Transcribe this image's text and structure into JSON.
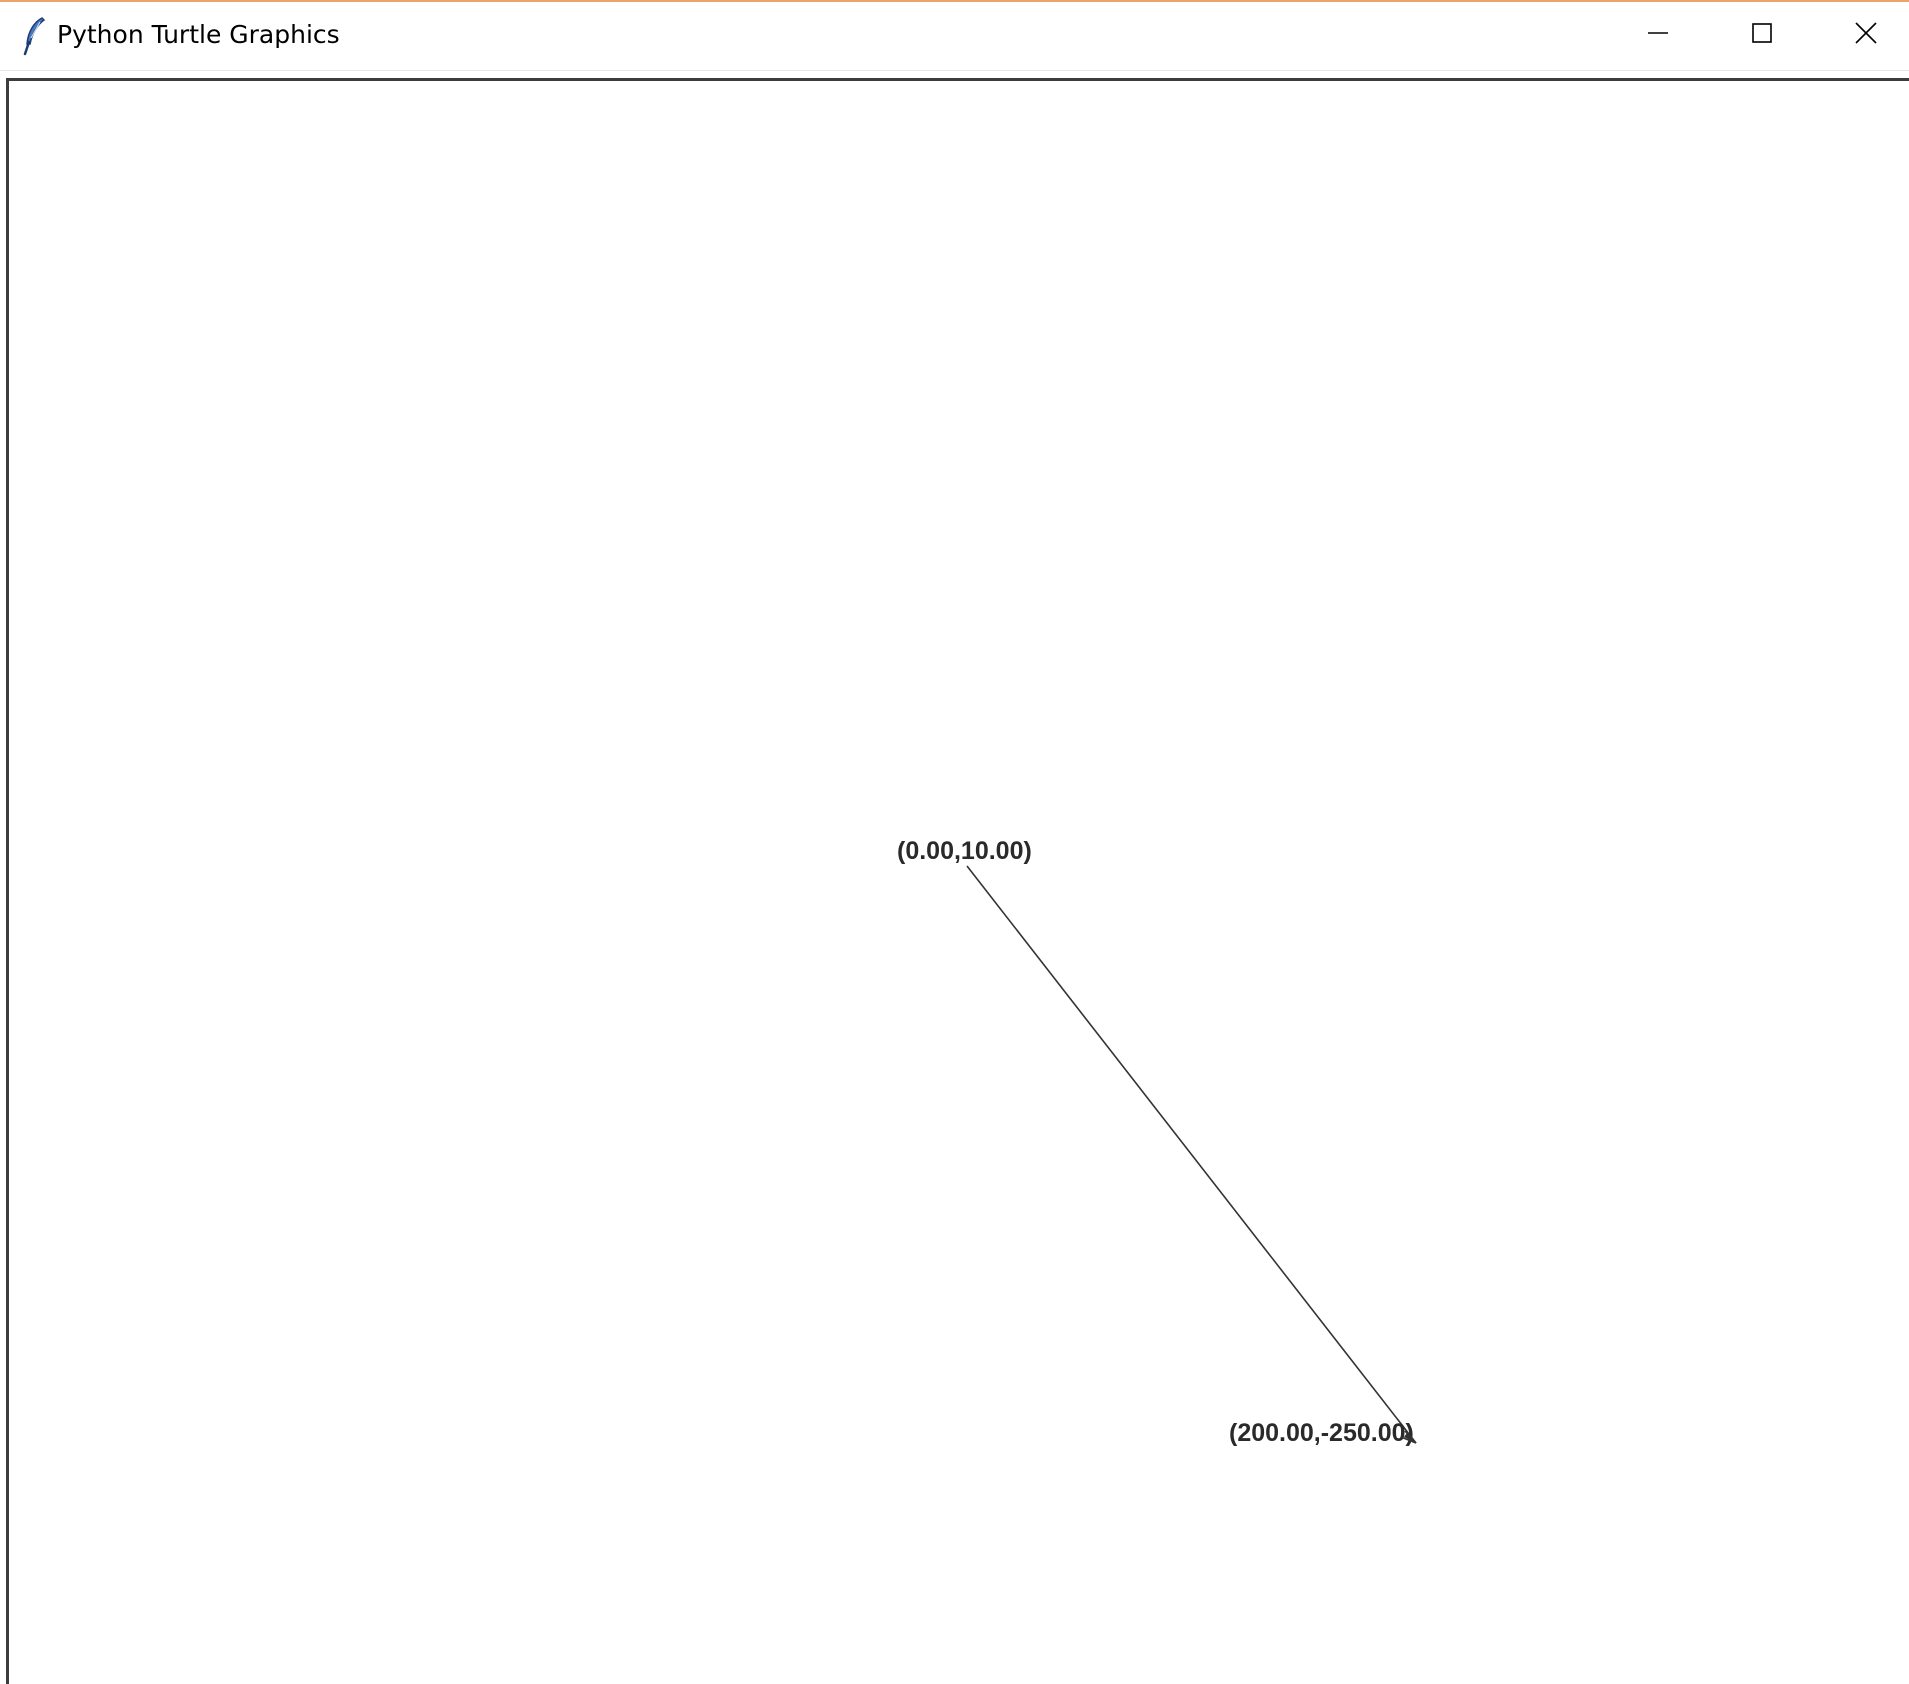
{
  "window": {
    "title": "Python Turtle Graphics",
    "icon": "feather-icon",
    "controls": {
      "minimize": "minimize-icon",
      "maximize": "maximize-icon",
      "close": "close-icon"
    }
  },
  "canvas": {
    "background": "#ffffff",
    "line_color": "#333333",
    "start_label": "(0.00,10.00)",
    "end_label": "(200.00,-250.00)",
    "segment": {
      "from": [
        0,
        10
      ],
      "to": [
        200,
        -250
      ]
    },
    "turtle_shape": "classic-arrow"
  },
  "colors": {
    "titlebar_accent": "#e9a36b",
    "border": "#3c3c3c"
  }
}
